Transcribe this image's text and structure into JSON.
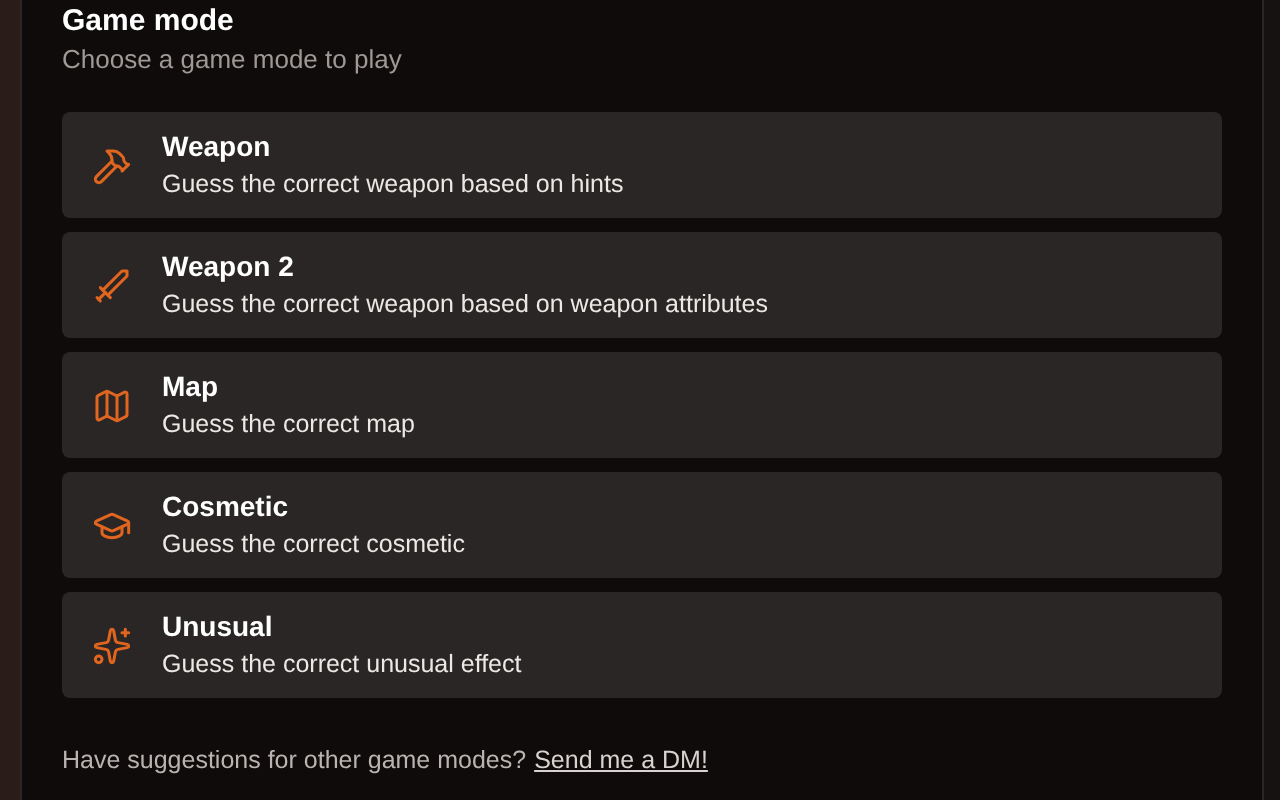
{
  "dialog": {
    "title": "Game mode",
    "subtitle": "Choose a game mode to play",
    "modes": [
      {
        "name": "Weapon",
        "description": "Guess the correct weapon based on hints"
      },
      {
        "name": "Weapon 2",
        "description": "Guess the correct weapon based on weapon attributes"
      },
      {
        "name": "Map",
        "description": "Guess the correct map"
      },
      {
        "name": "Cosmetic",
        "description": "Guess the correct cosmetic"
      },
      {
        "name": "Unusual",
        "description": "Guess the correct unusual effect"
      }
    ],
    "footer": {
      "text": "Have suggestions for other game modes?",
      "link": "Send me a DM!"
    }
  }
}
